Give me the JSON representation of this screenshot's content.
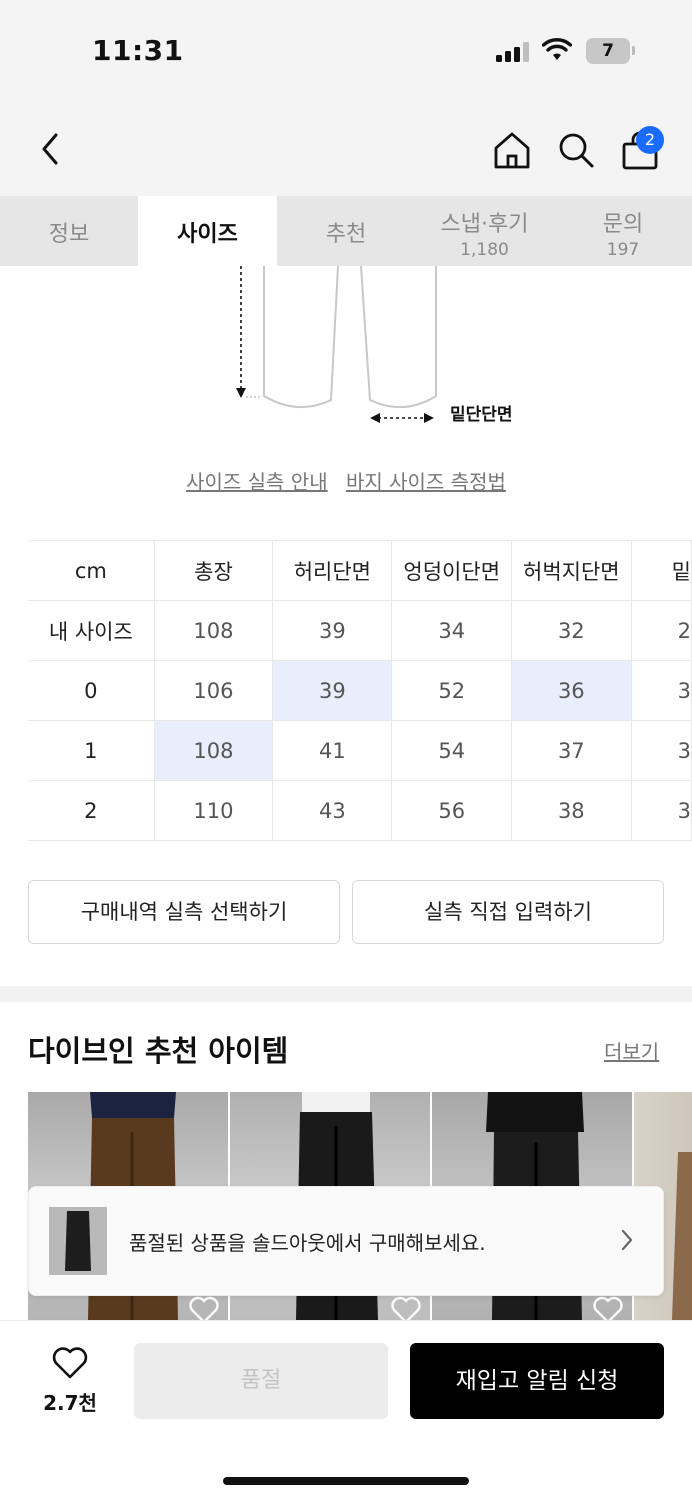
{
  "status": {
    "time": "11:31",
    "battery": "7"
  },
  "nav": {
    "cart_badge": "2"
  },
  "tabs": [
    {
      "label": "정보",
      "count": ""
    },
    {
      "label": "사이즈",
      "count": ""
    },
    {
      "label": "추천",
      "count": ""
    },
    {
      "label": "스냅·후기",
      "count": "1,180"
    },
    {
      "label": "문의",
      "count": "197"
    }
  ],
  "diagram": {
    "label": "밑단단면"
  },
  "guides": {
    "actual_size": "사이즈 실측 안내",
    "measure_method": "바지 사이즈 측정법"
  },
  "size_table": {
    "headers": [
      "cm",
      "총장",
      "허리단면",
      "엉덩이단면",
      "허벅지단면",
      "밑"
    ],
    "rows": [
      [
        "내 사이즈",
        "108",
        "39",
        "34",
        "32",
        "2"
      ],
      [
        "0",
        "106",
        "39",
        "52",
        "36",
        "3"
      ],
      [
        "1",
        "108",
        "41",
        "54",
        "37",
        "3"
      ],
      [
        "2",
        "110",
        "43",
        "56",
        "38",
        "3"
      ]
    ]
  },
  "buttons": {
    "select_purchase": "구매내역 실측 선택하기",
    "enter_direct": "실측 직접 입력하기"
  },
  "recommend": {
    "title": "다이브인 추천 아이템",
    "more": "더보기"
  },
  "soldout_banner": {
    "text": "품절된 상품을 솔드아웃에서 구매해보세요."
  },
  "bottom": {
    "like_count": "2.7천",
    "sold_out": "품절",
    "restock": "재입고 알림 신청"
  },
  "colors": {
    "accent": "#1a6bff",
    "highlight": "#e8eefc"
  }
}
